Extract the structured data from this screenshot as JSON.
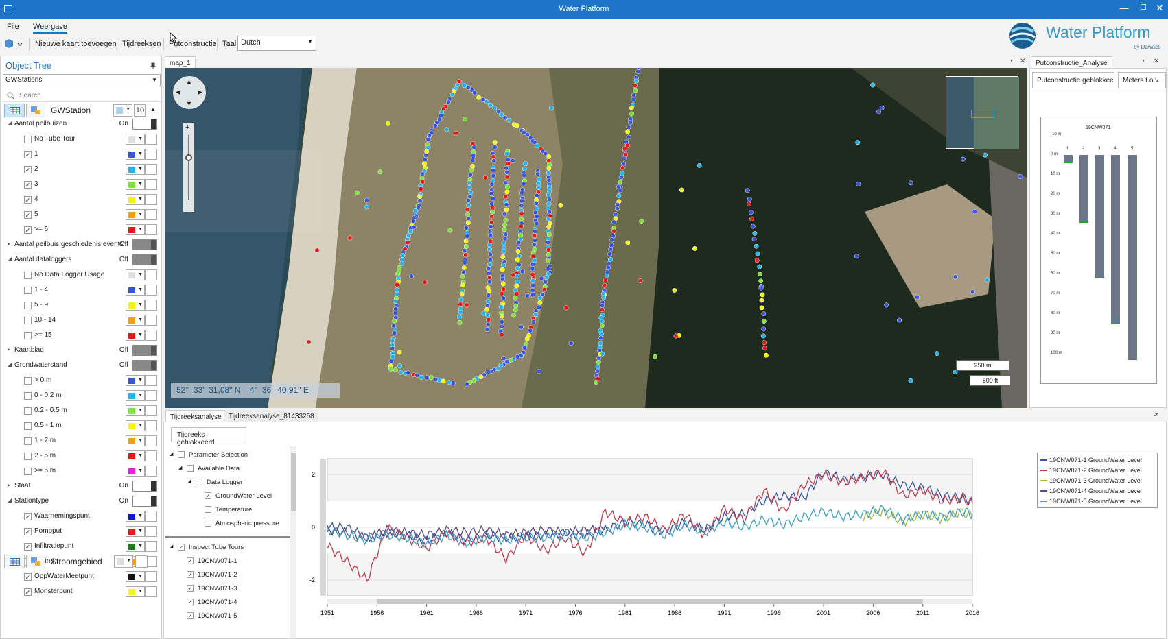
{
  "window": {
    "title": "Water Platform",
    "min": "—",
    "max": "☐",
    "close": "✕"
  },
  "menu": {
    "file": "File",
    "view": "Weergave"
  },
  "toolbar": {
    "add_map": "Nieuwe kaart toevoegen",
    "timeseries": "Tijdreeksen",
    "construction": "Putconstructie",
    "lang_label": "Taal",
    "lang_value": "Dutch"
  },
  "logo": {
    "name": "Water Platform",
    "by": "by Dawaco"
  },
  "object_tree": {
    "title": "Object Tree",
    "layer": "GWStations",
    "search_placeholder": "Search",
    "station": "GWStation",
    "size": "10",
    "sections": [
      {
        "label": "Aantal peilbuizen",
        "state": "On",
        "items": [
          {
            "label": "No Tube Tour",
            "color": "#e0e0e0",
            "checked": false
          },
          {
            "label": "1",
            "color": "#3a55d6",
            "checked": true
          },
          {
            "label": "2",
            "color": "#2ab0e8",
            "checked": true
          },
          {
            "label": "3",
            "color": "#7ee03a",
            "checked": true
          },
          {
            "label": "4",
            "color": "#f2f21e",
            "checked": true
          },
          {
            "label": "5",
            "color": "#f59c15",
            "checked": true
          },
          {
            "label": ">= 6",
            "color": "#e41a1a",
            "checked": true
          }
        ]
      },
      {
        "label": "Aantal peilbuis geschiedenis events",
        "state": "Off",
        "items": []
      },
      {
        "label": "Aantal dataloggers",
        "state": "Off",
        "items": [
          {
            "label": "No Data Logger Usage",
            "color": "#e0e0e0",
            "checked": false
          },
          {
            "label": "1 - 4",
            "color": "#3a55d6",
            "checked": false
          },
          {
            "label": "5 - 9",
            "color": "#f2f21e",
            "checked": false
          },
          {
            "label": "10 - 14",
            "color": "#f59c15",
            "checked": false
          },
          {
            "label": ">= 15",
            "color": "#e41a1a",
            "checked": false
          }
        ]
      },
      {
        "label": "Kaartblad",
        "state": "Off",
        "items": []
      },
      {
        "label": "Grondwaterstand",
        "state": "Off",
        "items": [
          {
            "label": "> 0 m",
            "color": "#3a55d6",
            "checked": false
          },
          {
            "label": "0 - 0.2 m",
            "color": "#2ab0e8",
            "checked": false
          },
          {
            "label": "0.2 - 0.5 m",
            "color": "#7ee03a",
            "checked": false
          },
          {
            "label": "0.5 - 1 m",
            "color": "#f2f21e",
            "checked": false
          },
          {
            "label": "1 - 2 m",
            "color": "#f59c15",
            "checked": false
          },
          {
            "label": "2 - 5 m",
            "color": "#e41a1a",
            "checked": false
          },
          {
            "label": ">= 5 m",
            "color": "#e81ee8",
            "checked": false
          }
        ]
      },
      {
        "label": "Staat",
        "state": "On",
        "items": []
      },
      {
        "label": "Stationtype",
        "state": "On",
        "items": [
          {
            "label": "Waarnemingspunt",
            "color": "#1414e0",
            "checked": true
          },
          {
            "label": "Pompput",
            "color": "#e41a1a",
            "checked": true
          },
          {
            "label": "Infiltratiepunt",
            "color": "#1a7a1a",
            "checked": true
          },
          {
            "label": "Boring",
            "color": "#f59c15",
            "checked": true
          },
          {
            "label": "OppWaterMeetpunt",
            "color": "#111111",
            "checked": true
          },
          {
            "label": "Monsterpunt",
            "color": "#f2f21e",
            "checked": true
          }
        ]
      }
    ],
    "footer_label": "Stroomgebied"
  },
  "map": {
    "tab": "map_1",
    "lat_deg": "52°",
    "lat_min": "33'",
    "lat_sec": "31,08\" N",
    "lon_deg": "4°",
    "lon_min": "36'",
    "lon_sec": "40,91\" E",
    "scale_m": "250 m",
    "scale_ft": "500 ft"
  },
  "well": {
    "tab": "Putconstructie_Analyse",
    "btn_locked": "Putconstructie geblokkeerd",
    "btn_meters": "Meters t.o.v.",
    "station": "19CNW071",
    "depth_labels": [
      "-10 m",
      "0 m",
      "10 m",
      "20 m",
      "30 m",
      "40 m",
      "50 m",
      "60 m",
      "70 m",
      "80 m",
      "90 m",
      "100 m"
    ],
    "tubes": [
      "1",
      "2",
      "3",
      "4",
      "5"
    ],
    "tube_depths_m": [
      4,
      34,
      62,
      85,
      103
    ]
  },
  "ts": {
    "tab1": "Tijdreeksanalyse",
    "tab2": "Tijdreeksanalyse_81433258",
    "btn_locked": "Tijdreeks geblokkeerd",
    "tree1": [
      {
        "label": "Parameter Selection",
        "level": 0,
        "checked": false
      },
      {
        "label": "Available Data",
        "level": 1,
        "checked": false
      },
      {
        "label": "Data Logger",
        "level": 2,
        "checked": false
      },
      {
        "label": "GroundWater Level",
        "level": 3,
        "checked": true
      },
      {
        "label": "Temperature",
        "level": 3,
        "checked": false
      },
      {
        "label": "Atmospheric pressure",
        "level": 3,
        "checked": false
      }
    ],
    "tree2": [
      {
        "label": "Inspect Tube Tours",
        "level": 0,
        "checked": true
      },
      {
        "label": "19CNW071-1",
        "level": 1,
        "checked": true
      },
      {
        "label": "19CNW071-2",
        "level": 1,
        "checked": true
      },
      {
        "label": "19CNW071-3",
        "level": 1,
        "checked": true
      },
      {
        "label": "19CNW071-4",
        "level": 1,
        "checked": true
      },
      {
        "label": "19CNW071-5",
        "level": 1,
        "checked": true
      }
    ]
  },
  "chart_data": {
    "type": "line",
    "xlim": [
      1951,
      2016
    ],
    "ylim": [
      -2.6,
      2.6
    ],
    "x_ticks": [
      "1951",
      "1956",
      "1961",
      "1966",
      "1971",
      "1976",
      "1981",
      "1986",
      "1991",
      "1996",
      "2001",
      "2006",
      "2011",
      "2016"
    ],
    "y_ticks": [
      "2",
      "0",
      "-2"
    ],
    "legend": "top-right",
    "series": [
      {
        "name": "19CNW071-1 GroundWater Level",
        "color": "#3c54a8",
        "x": [
          1951,
          1953,
          1955,
          1957,
          1959,
          1961,
          1963,
          1965,
          1967,
          1969,
          1971,
          1973,
          1975,
          1977,
          1979,
          1981,
          1983,
          1985,
          1987,
          1989,
          1991,
          1993,
          1995,
          1997,
          1999,
          2001,
          2003,
          2005,
          2007,
          2009,
          2011,
          2013,
          2015,
          2016
        ],
        "y": [
          0,
          0,
          -0.4,
          -0.2,
          -0.3,
          -0.5,
          -0.2,
          -0.5,
          -0.3,
          -0.4,
          -0.3,
          -0.3,
          -0.2,
          -0.3,
          -0.1,
          0.2,
          0.1,
          -0.2,
          0.2,
          -0.1,
          0.4,
          0.5,
          1.0,
          1.2,
          1.1,
          2.1,
          1.8,
          1.9,
          2.0,
          1.6,
          1.5,
          1.2,
          1.1,
          1.0
        ]
      },
      {
        "name": "19CNW071-2 GroundWater Level",
        "color": "#c43a4a",
        "x": [
          1951,
          1953,
          1955,
          1957,
          1959,
          1961,
          1963,
          1965,
          1967,
          1969,
          1971,
          1973,
          1975,
          1977,
          1979,
          1981,
          1983,
          1985,
          1987,
          1989,
          1991,
          1993,
          1995,
          1997,
          1999,
          2001,
          2003,
          2005,
          2007,
          2009,
          2011,
          2013,
          2015,
          2016
        ],
        "y": [
          -0.7,
          -1.3,
          -2.0,
          0,
          -0.4,
          -0.8,
          -0.2,
          -0.6,
          -0.4,
          -1.2,
          -0.3,
          -0.9,
          -0.4,
          -1.0,
          0.6,
          0.2,
          0.4,
          -0.1,
          0.5,
          -0.3,
          0.7,
          0.3,
          1.4,
          0.6,
          1.6,
          2.0,
          1.7,
          1.9,
          2.1,
          1.2,
          1.4,
          1.0,
          1.1,
          0.9
        ]
      },
      {
        "name": "19CNW071-3 GroundWater Level",
        "color": "#9aba3c",
        "x": [
          2005,
          2007,
          2009,
          2011,
          2013,
          2015,
          2016
        ],
        "y": [
          0.4,
          0.6,
          0.2,
          0.5,
          0.3,
          0.6,
          0.4
        ]
      },
      {
        "name": "19CNW071-4 GroundWater Level",
        "color": "#5e4a8a",
        "x": [
          1951,
          1953,
          1955,
          1957,
          1959,
          1961,
          1963,
          1965,
          1967,
          1969,
          1971,
          1973,
          1975,
          1977,
          1979
        ],
        "y": [
          -0.1,
          -0.2,
          -0.4,
          -0.1,
          -0.2,
          -0.3,
          -0.1,
          -0.2,
          -0.1,
          -0.3,
          -0.2,
          -0.1,
          -0.2,
          -0.1,
          -0.1
        ]
      },
      {
        "name": "19CNW071-5 GroundWater Level",
        "color": "#3aa0c8",
        "x": [
          1951,
          1953,
          1955,
          1957,
          1959,
          1961,
          1963,
          1965,
          1967,
          1969,
          1971,
          1973,
          1975,
          1977,
          1979,
          1981,
          1983,
          1985,
          1987,
          1989,
          1991,
          1993,
          1995,
          1997,
          1999,
          2001,
          2003,
          2005,
          2007,
          2009,
          2011,
          2013,
          2015,
          2016
        ],
        "y": [
          -0.1,
          -0.3,
          -0.5,
          -0.3,
          -0.4,
          -0.6,
          -0.3,
          -0.6,
          -0.4,
          -0.5,
          -0.4,
          -0.4,
          -0.3,
          -0.4,
          -0.2,
          0.1,
          0,
          -0.3,
          0.1,
          -0.2,
          0.2,
          0,
          0.3,
          0.1,
          0.4,
          0.6,
          0.4,
          0.5,
          0.7,
          0.3,
          0.5,
          0.4,
          0.6,
          0.5
        ]
      }
    ]
  }
}
